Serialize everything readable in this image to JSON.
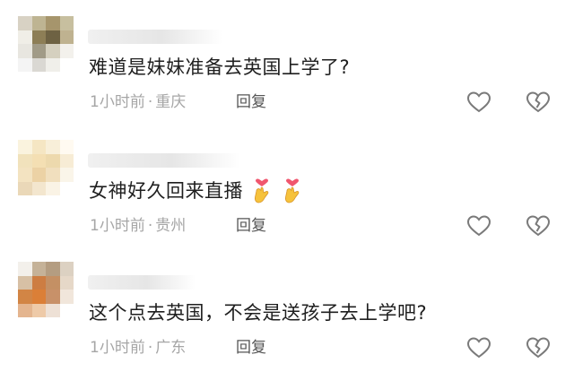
{
  "comments": [
    {
      "avatar_colors": [
        "#d9d2c2",
        "#bfb48e",
        "#a89567",
        "#c8bf9b",
        "#f0eee6",
        "#8f7e52",
        "#6f6240",
        "#c0b28c",
        "#e8e6df",
        "#a29b85",
        "#d6d0bd",
        "#f3f1eb",
        "#f4f4f4",
        "#dad8d2",
        "#f0efea",
        "#ffffff"
      ],
      "text": "难道是妹妹准备去英国上学了?",
      "time": "1小时前",
      "separator": "·",
      "location": "重庆",
      "reply": "回复",
      "emojis": []
    },
    {
      "avatar_colors": [
        "#fbf3dc",
        "#f7e6bf",
        "#f9efd6",
        "#fffaf0",
        "#f3e2b8",
        "#f6dfae",
        "#efd9a8",
        "#f8ecd2",
        "#f5e3bd",
        "#efd2a0",
        "#f3dfba",
        "#fbf5e8",
        "#ecd8b4",
        "#f4e6cb",
        "#fbf3e3",
        "#ffffff"
      ],
      "text": "女神好久回来直播",
      "time": "1小时前",
      "separator": "·",
      "location": "贵州",
      "reply": "回复",
      "emojis": [
        "heart-hands",
        "heart-hands"
      ]
    },
    {
      "avatar_colors": [
        "#f3f0ea",
        "#c7b295",
        "#b69d7d",
        "#ddd1c0",
        "#d9c0a2",
        "#d47c3a",
        "#c98f5e",
        "#e7d8c6",
        "#d9843d",
        "#e47d2d",
        "#cd9064",
        "#f2e6da",
        "#e8b48a",
        "#f1c9a4",
        "#efe1d4",
        "#ffffff"
      ],
      "text": "这个点去英国，不会是送孩子去上学吧?",
      "time": "1小时前",
      "separator": "·",
      "location": "广东",
      "reply": "回复",
      "emojis": []
    }
  ],
  "icons": {
    "like": "heart-outline-icon",
    "dislike": "broken-heart-icon"
  },
  "colors": {
    "text": "#1f1f1f",
    "meta": "#a6a6a6",
    "reply": "#555555",
    "icon": "#7a7a7a",
    "emoji_heart": "#f0566e",
    "emoji_hand": "#f6c23c"
  }
}
